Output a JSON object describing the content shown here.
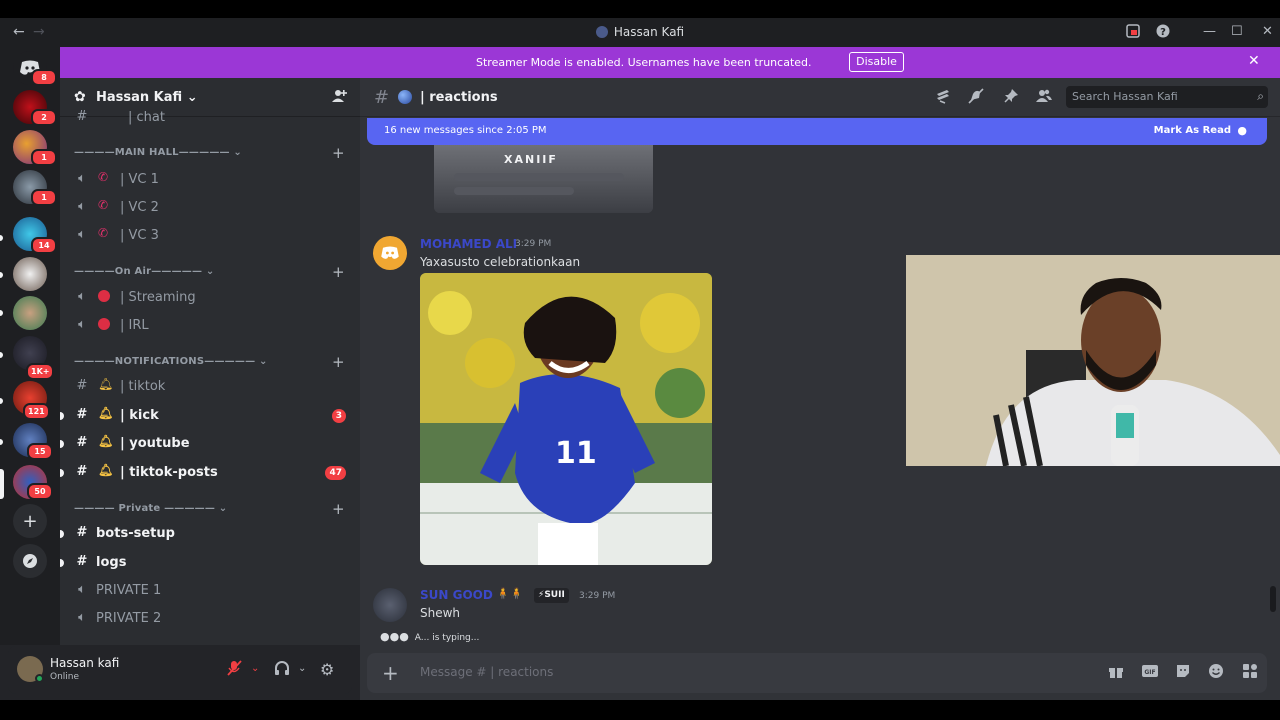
{
  "window": {
    "title": "Hassan Kafi",
    "back_icon": "←",
    "forward_icon": "→"
  },
  "banner": {
    "text": "Streamer Mode is enabled. Usernames have been truncated.",
    "button": "Disable"
  },
  "rail": {
    "badges": [
      "8",
      "2",
      "1",
      "1",
      "14",
      "1K+",
      "121",
      "15",
      "50"
    ]
  },
  "server": {
    "name": "Hassan Kafi ⌄"
  },
  "sidebar": {
    "top_partial": "| chat",
    "categories": {
      "main_hall": "————MAIN HALL————— ⌄",
      "on_air": "————On Air————— ⌄",
      "notifications": "————NOTIFICATIONS————— ⌄",
      "private": "———— Private ————— ⌄"
    },
    "channels": {
      "vc1": "| VC 1",
      "vc2": "| VC 2",
      "vc3": "| VC 3",
      "streaming": "| Streaming",
      "irl": "| IRL",
      "tiktok": "| tiktok",
      "kick": "| kick",
      "kick_badge": "3",
      "youtube": "| youtube",
      "tiktok_posts": "| tiktok-posts",
      "tiktok_posts_badge": "47",
      "bots_setup": "bots-setup",
      "logs": "logs",
      "private1": "PRIVATE 1",
      "private2": "PRIVATE 2"
    }
  },
  "user": {
    "name": "Hassan kafi",
    "status": "Online"
  },
  "channel_header": {
    "title": "| reactions",
    "search_placeholder": "Search Hassan Kafi"
  },
  "new_messages": {
    "text": "16 new messages since 2:05 PM",
    "action": "Mark As Read"
  },
  "messages": [
    {
      "author": "MOHAMED ALI",
      "time": "3:29 PM",
      "text": "Yaxasusto  celebrationkaan"
    },
    {
      "author": "SUN GOOD",
      "tag": "⚡SUII",
      "time": "3:29 PM",
      "text": "Shewh"
    }
  ],
  "old_image_text": "XANIIF",
  "photo_jersey_number": "11",
  "typing": "A... is typing...",
  "composer": {
    "placeholder": "Message #  |  reactions"
  }
}
